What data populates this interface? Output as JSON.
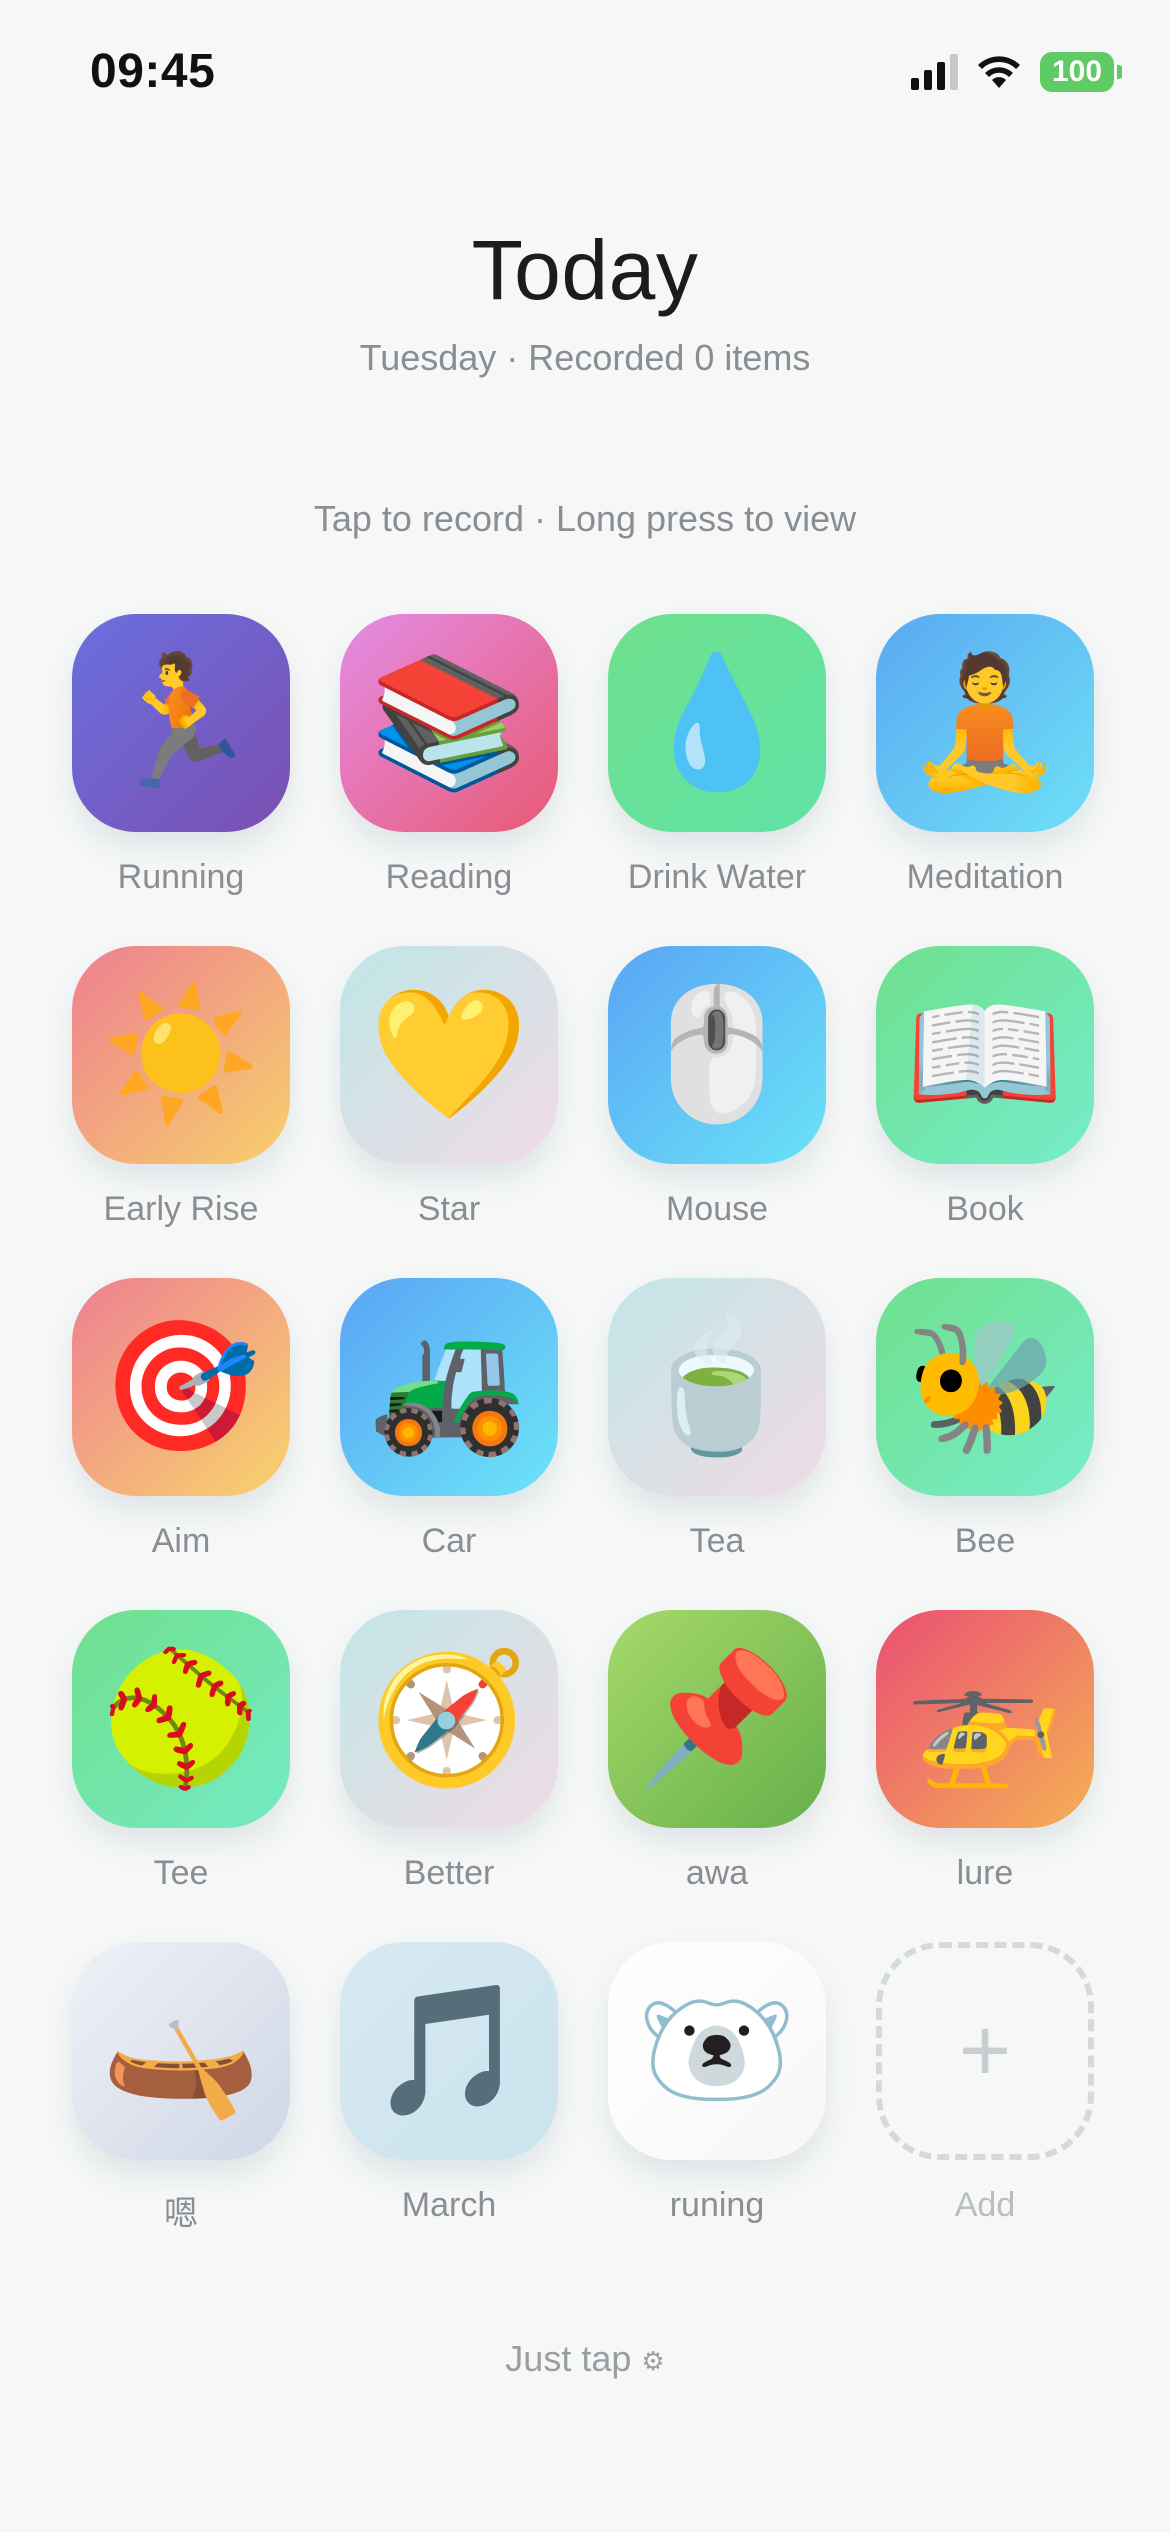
{
  "status_bar": {
    "time": "09:45",
    "battery": "100"
  },
  "header": {
    "title": "Today",
    "subtitle": "Tuesday · Recorded 0 items"
  },
  "hint": "Tap to record · Long press to view",
  "items": [
    {
      "label": "Running",
      "icon": "🏃",
      "icon_name": "running-person-icon",
      "gradient": [
        "#6a6fe0",
        "#7b4fb0"
      ]
    },
    {
      "label": "Reading",
      "icon": "📚",
      "icon_name": "books-icon",
      "gradient": [
        "#e48ce6",
        "#e85a73"
      ]
    },
    {
      "label": "Drink Water",
      "icon": "💧",
      "icon_name": "water-drop-icon",
      "gradient": [
        "#6fe08d",
        "#5fe3a6"
      ]
    },
    {
      "label": "Meditation",
      "icon": "🧘",
      "icon_name": "meditation-icon",
      "gradient": [
        "#5aa9f2",
        "#6ee0f6"
      ]
    },
    {
      "label": "Early Rise",
      "icon": "☀️",
      "icon_name": "sun-icon",
      "gradient": [
        "#ee7f91",
        "#f7d06b"
      ]
    },
    {
      "label": "Star",
      "icon": "💛",
      "icon_name": "heart-icon",
      "gradient": [
        "#bfe6e6",
        "#f1dbe6"
      ]
    },
    {
      "label": "Mouse",
      "icon": "🖱️",
      "icon_name": "mouse-icon",
      "gradient": [
        "#5aa5f4",
        "#69e2f8"
      ]
    },
    {
      "label": "Book",
      "icon": "📖",
      "icon_name": "open-book-icon",
      "gradient": [
        "#6ee08e",
        "#76eccb"
      ]
    },
    {
      "label": "Aim",
      "icon": "🎯",
      "icon_name": "target-icon",
      "gradient": [
        "#ee7f92",
        "#f8d46c"
      ]
    },
    {
      "label": "Car",
      "icon": "🚜",
      "icon_name": "tractor-icon",
      "gradient": [
        "#5aa4f4",
        "#6ce4f8"
      ]
    },
    {
      "label": "Tea",
      "icon": "🍵",
      "icon_name": "tea-icon",
      "gradient": [
        "#c2e6e6",
        "#f0dbe4"
      ]
    },
    {
      "label": "Bee",
      "icon": "🐝",
      "icon_name": "bee-icon",
      "gradient": [
        "#6fe08d",
        "#77eccb"
      ]
    },
    {
      "label": "Tee",
      "icon": "🥎",
      "icon_name": "softball-icon",
      "gradient": [
        "#6fe08e",
        "#75eac4"
      ]
    },
    {
      "label": "Better",
      "icon": "🧭",
      "icon_name": "compass-icon",
      "gradient": [
        "#c2e6e6",
        "#f0dbe4"
      ]
    },
    {
      "label": "awa",
      "icon": "📌",
      "icon_name": "pushpin-icon",
      "gradient": [
        "#a6d96a",
        "#66b04a"
      ]
    },
    {
      "label": "lure",
      "icon": "🚁",
      "icon_name": "helicopter-icon",
      "gradient": [
        "#ea4f73",
        "#f5b055"
      ]
    },
    {
      "label": "嗯",
      "icon": "🛶",
      "icon_name": "canoe-icon",
      "gradient": [
        "#eff1f6",
        "#cfd7e6"
      ]
    },
    {
      "label": "March",
      "icon": "🎵",
      "icon_name": "music-note-icon",
      "gradient": [
        "#d8e9f1",
        "#cae3ee"
      ]
    },
    {
      "label": "runing",
      "icon": "🐻‍❄️",
      "icon_name": "polar-bear-icon",
      "gradient": [
        "#ffffff",
        "#f7f7f7"
      ]
    }
  ],
  "add": {
    "label": "Add",
    "icon": "+"
  },
  "footer": {
    "text": "Just tap",
    "icon": "⚙"
  }
}
